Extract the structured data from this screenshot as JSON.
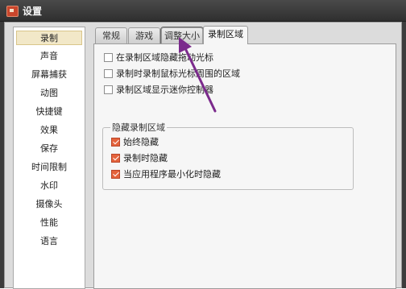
{
  "window": {
    "title": "设置"
  },
  "sidebar": {
    "items": [
      {
        "label": "录制",
        "active": true
      },
      {
        "label": "声音"
      },
      {
        "label": "屏幕捕获"
      },
      {
        "label": "动图"
      },
      {
        "label": "快捷键"
      },
      {
        "label": "效果"
      },
      {
        "label": "保存"
      },
      {
        "label": "时间限制"
      },
      {
        "label": "水印"
      },
      {
        "label": "摄像头"
      },
      {
        "label": "性能"
      },
      {
        "label": "语言"
      }
    ]
  },
  "tabs": [
    {
      "label": "常规"
    },
    {
      "label": "游戏"
    },
    {
      "label": "调整大小",
      "highlighted": true
    },
    {
      "label": "录制区域",
      "active": true
    }
  ],
  "options": [
    {
      "label": "在录制区域隐藏拖动光标",
      "checked": false
    },
    {
      "label": "录制时录制鼠标光标周围的区域",
      "checked": false
    },
    {
      "label": "录制区域显示迷你控制器",
      "checked": false
    }
  ],
  "hide_group": {
    "title": "隐藏录制区域",
    "options": [
      {
        "label": "始终隐藏",
        "checked": true
      },
      {
        "label": "录制时隐藏",
        "checked": true
      },
      {
        "label": "当应用程序最小化时隐藏",
        "checked": true
      }
    ]
  },
  "colors": {
    "arrow": "#7b2a8c",
    "checkbox_checked": "#e5633c",
    "active_nav": "#f2e8c8"
  }
}
